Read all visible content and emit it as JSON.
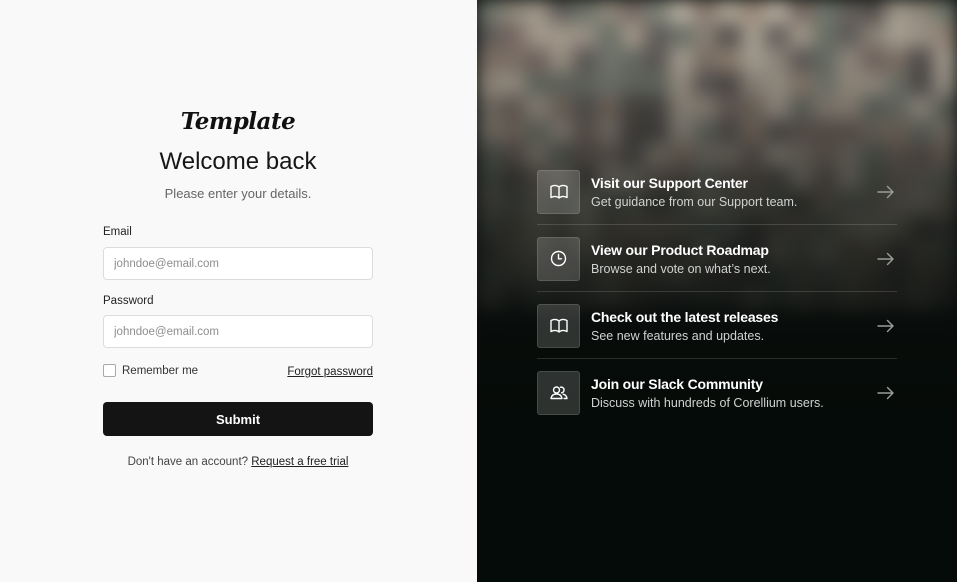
{
  "login": {
    "logo": "Template",
    "title": "Welcome back",
    "subtitle": "Please enter your details.",
    "email_label": "Email",
    "email_placeholder": "johndoe@email.com",
    "password_label": "Password",
    "password_placeholder": "johndoe@email.com",
    "remember_label": "Remember me",
    "remember_checked": false,
    "forgot_label": "Forgot password",
    "submit_label": "Submit",
    "signup_text": "Don't have an account?",
    "signup_link": "Request a free trial"
  },
  "resources": [
    {
      "icon": "book-icon",
      "title": "Visit our Support Center",
      "subtitle": "Get guidance from our Support team."
    },
    {
      "icon": "clock-icon",
      "title": "View our Product Roadmap",
      "subtitle": "Browse and vote on what’s next."
    },
    {
      "icon": "book-icon",
      "title": "Check out the latest releases",
      "subtitle": "See new features and updates."
    },
    {
      "icon": "users-icon",
      "title": "Join our Slack Community",
      "subtitle": "Discuss with hundreds of Corellium users."
    }
  ],
  "colors": {
    "submit_bg": "#141414",
    "panel_bg": "#050b08",
    "left_bg": "#f9f9f9"
  }
}
